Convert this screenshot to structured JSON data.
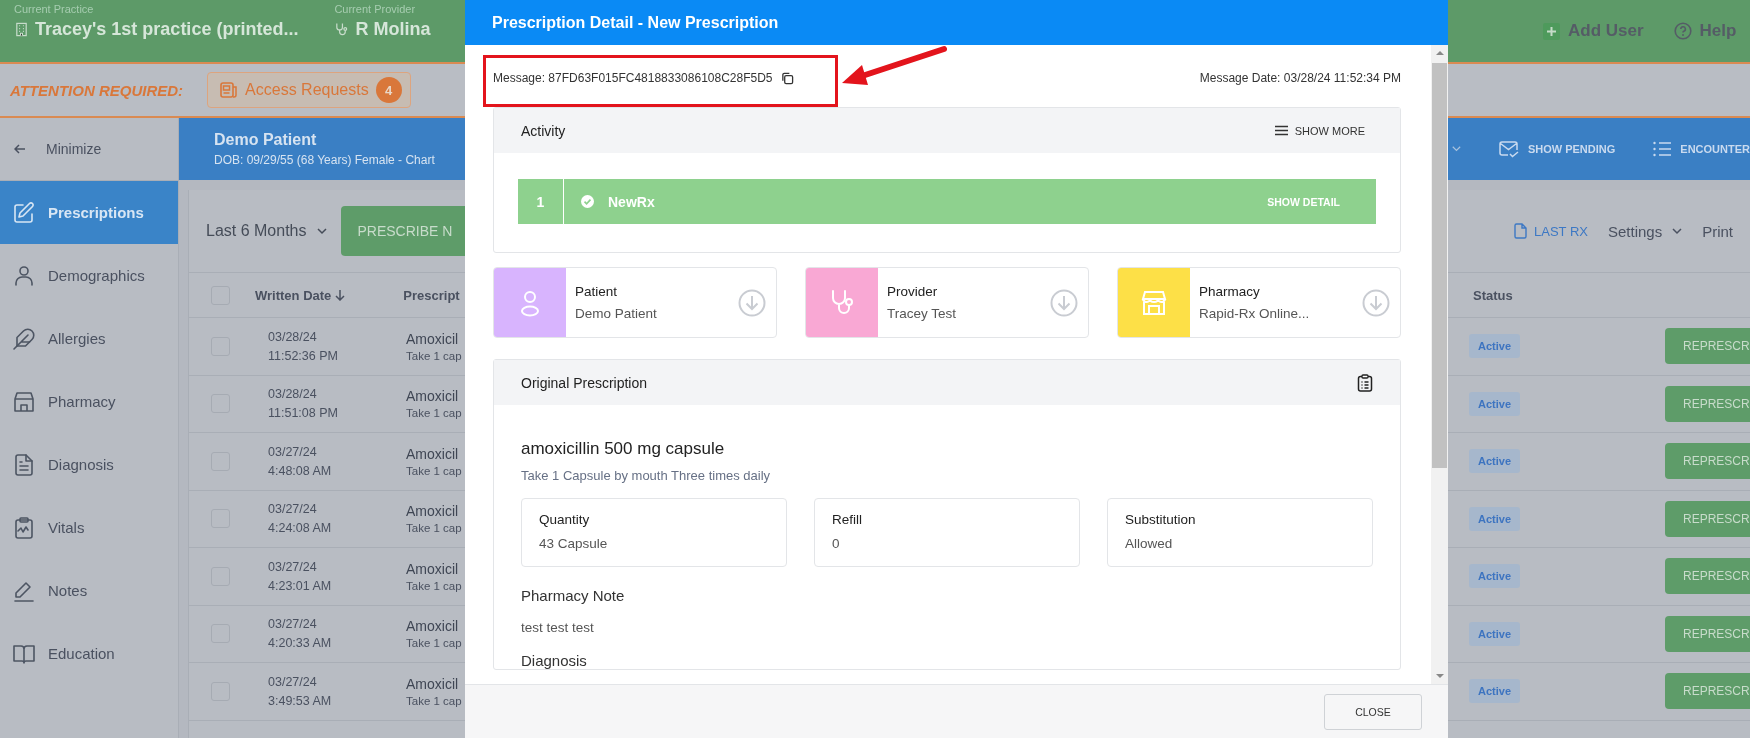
{
  "header": {
    "practice_label": "Current Practice",
    "practice": "Tracey's 1st practice (printed...",
    "provider_label": "Current Provider",
    "provider": "R Molina",
    "actions": [
      {
        "kind": "add",
        "label": "Add User"
      },
      {
        "kind": "help",
        "label": "Help"
      }
    ]
  },
  "attention": {
    "label": "ATTENTION REQUIRED:",
    "button": "Access Requests",
    "count": "4"
  },
  "sidebar": {
    "minimize": "Minimize",
    "items": [
      {
        "label": "Prescriptions",
        "selected": true
      },
      {
        "label": "Demographics",
        "selected": false
      },
      {
        "label": "Allergies",
        "selected": false
      },
      {
        "label": "Pharmacy",
        "selected": false
      },
      {
        "label": "Diagnosis",
        "selected": false
      },
      {
        "label": "Vitals",
        "selected": false
      },
      {
        "label": "Notes",
        "selected": false
      },
      {
        "label": "Education",
        "selected": false
      }
    ]
  },
  "patient": {
    "name": "Demo Patient",
    "details": "DOB: 09/29/55 (68 Years) Female - Chart",
    "actions": [
      {
        "kind": "mail",
        "label": "SHOW PENDING"
      },
      {
        "kind": "list",
        "label": "ENCOUNTER"
      }
    ]
  },
  "toolbar": {
    "range": "Last 6 Months",
    "prescribe": "PRESCRIBE N",
    "last_rx": "LAST RX",
    "settings": "Settings",
    "print": "Print"
  },
  "table": {
    "columns": [
      "Written Date",
      "Prescript",
      "Status"
    ],
    "all_checked": false,
    "rows": [
      {
        "checked": false,
        "date": "03/28/24",
        "time": "11:52:36 PM",
        "drug": "Amoxicil",
        "sig": "Take 1 cap",
        "status": "Active",
        "action": "REPRESCR"
      },
      {
        "checked": false,
        "date": "03/28/24",
        "time": "11:51:08 PM",
        "drug": "Amoxicil",
        "sig": "Take 1 cap",
        "status": "Active",
        "action": "REPRESCR"
      },
      {
        "checked": false,
        "date": "03/27/24",
        "time": "4:48:08 AM",
        "drug": "Amoxicil",
        "sig": "Take 1 cap",
        "status": "Active",
        "action": "REPRESCR"
      },
      {
        "checked": false,
        "date": "03/27/24",
        "time": "4:24:08 AM",
        "drug": "Amoxicil",
        "sig": "Take 1 cap",
        "status": "Active",
        "action": "REPRESCR"
      },
      {
        "checked": false,
        "date": "03/27/24",
        "time": "4:23:01 AM",
        "drug": "Amoxicil",
        "sig": "Take 1 cap",
        "status": "Active",
        "action": "REPRESCR"
      },
      {
        "checked": false,
        "date": "03/27/24",
        "time": "4:20:33 AM",
        "drug": "Amoxicil",
        "sig": "Take 1 cap",
        "status": "Active",
        "action": "REPRESCR"
      },
      {
        "checked": false,
        "date": "03/27/24",
        "time": "3:49:53 AM",
        "drug": "Amoxicil",
        "sig": "Take 1 cap",
        "status": "Active",
        "action": "REPRESCR"
      }
    ]
  },
  "modal": {
    "title": "Prescription Detail - New Prescription",
    "message_label": "Message:",
    "message_id": "87FD63F015FC4818833086108C28F5D5",
    "message_date": "Message Date: 03/28/24 11:52:34 PM",
    "activity": {
      "title": "Activity",
      "show_more": "SHOW MORE",
      "steps": [
        {
          "number": "1",
          "name": "NewRx",
          "action": "SHOW DETAIL",
          "done": true
        }
      ]
    },
    "parties": [
      {
        "kind": "patient",
        "title": "Patient",
        "value": "Demo Patient",
        "color": "#d8b4fe"
      },
      {
        "kind": "provider",
        "title": "Provider",
        "value": "Tracey Test",
        "color": "#f9a8d4"
      },
      {
        "kind": "pharmacy",
        "title": "Pharmacy",
        "value": "Rapid-Rx Online...",
        "color": "#fde047"
      }
    ],
    "original": {
      "title": "Original Prescription",
      "drug": "amoxicillin 500 mg capsule",
      "sig": "Take 1 Capsule by mouth Three times daily",
      "fields": [
        {
          "label": "Quantity",
          "value": "43 Capsule"
        },
        {
          "label": "Refill",
          "value": "0"
        },
        {
          "label": "Substitution",
          "value": "Allowed"
        }
      ],
      "note_label": "Pharmacy Note",
      "note": "test test test",
      "diagnosis_label": "Diagnosis"
    },
    "close": "CLOSE"
  }
}
